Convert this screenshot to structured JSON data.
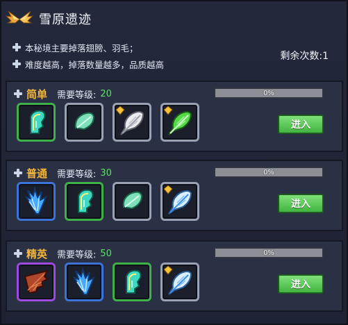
{
  "header": {
    "title": "雪原遗迹"
  },
  "description": {
    "lines": [
      "本秘境主要掉落翅膀、羽毛；",
      "难度越高，掉落数量越多，品质越高"
    ]
  },
  "remaining": {
    "text": "剩余次数:1"
  },
  "sections": [
    {
      "difficulty": "简单",
      "level_label": "需要等级:",
      "level_value": "20",
      "progress_text": "0%",
      "progress_fraction": 0,
      "enter_label": "进入",
      "items": [
        "green-wing-icon",
        "green-feather-icon",
        "white-feather-icon",
        "green-feather-icon"
      ]
    },
    {
      "difficulty": "普通",
      "level_label": "需要等级:",
      "level_value": "30",
      "progress_text": "0%",
      "progress_fraction": 0,
      "enter_label": "进入",
      "items": [
        "blue-wing-icon",
        "green-wing-icon",
        "green-feather-icon",
        "blue-feather-icon"
      ]
    },
    {
      "difficulty": "精英",
      "level_label": "需要等级:",
      "level_value": "50",
      "progress_text": "0%",
      "progress_fraction": 0,
      "enter_label": "进入",
      "items": [
        "bat-wing-icon",
        "blue-wing-icon",
        "green-wing-icon",
        "blue-feather-icon"
      ]
    }
  ],
  "colors": {
    "difficulty": "#f3b53a",
    "level_value": "#5fe069",
    "enter_button": "#41b53f"
  }
}
